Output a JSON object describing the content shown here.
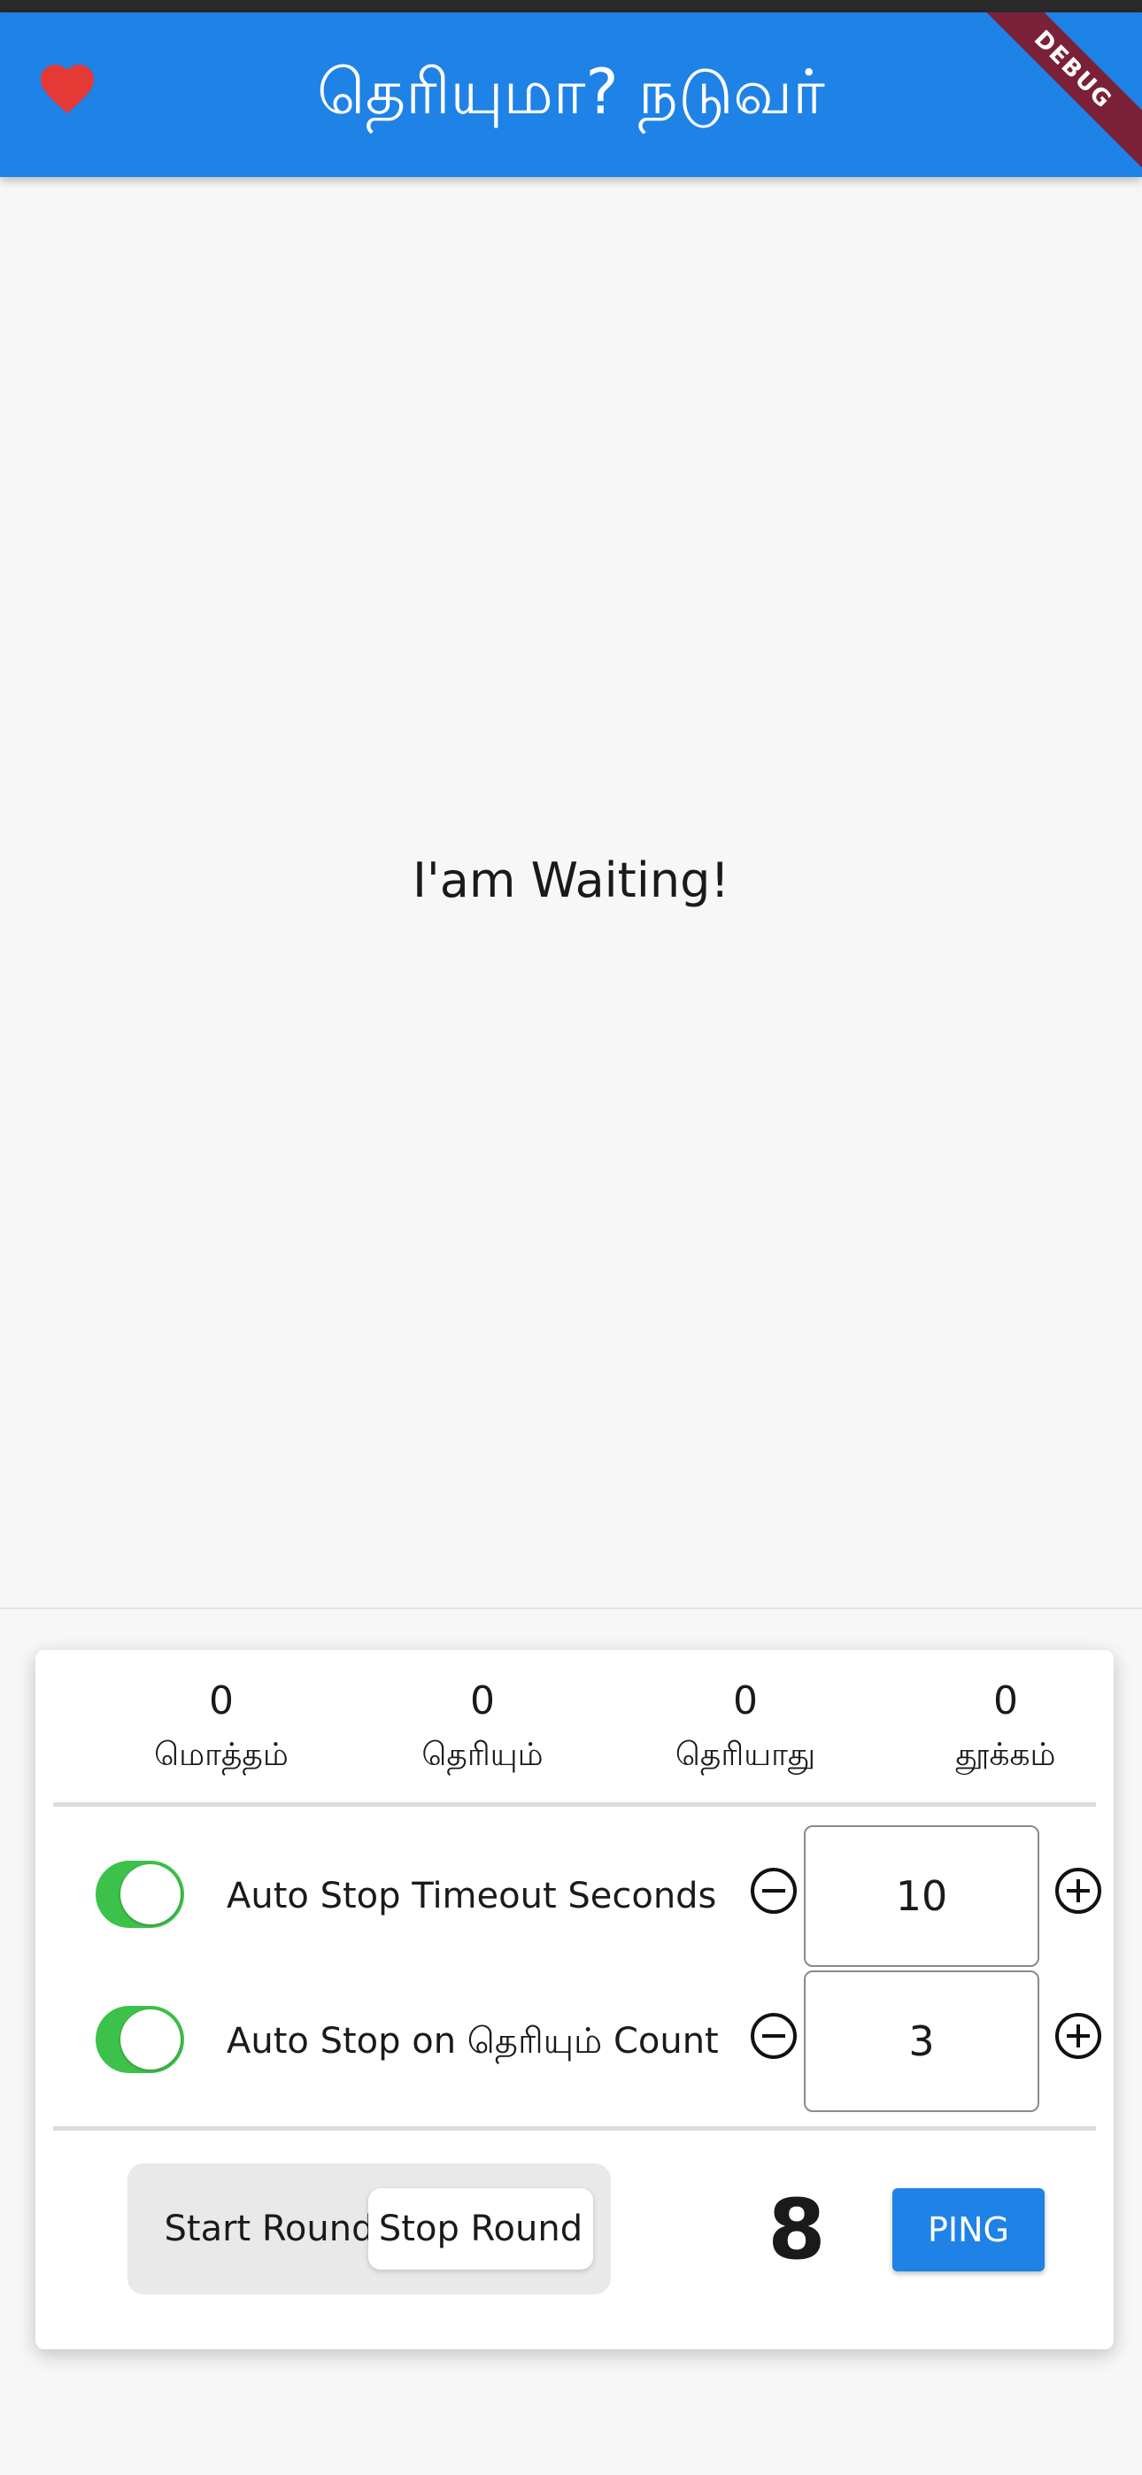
{
  "app_bar": {
    "title": "தெரியுமா? நடுவர்",
    "debug_label": "DEBUG",
    "heart_icon": "heart-icon",
    "accent_color": "#1f82e6"
  },
  "main": {
    "status_text": "I'am Waiting!"
  },
  "stats": [
    {
      "value": "0",
      "label": "மொத்தம்"
    },
    {
      "value": "0",
      "label": "தெரியும்"
    },
    {
      "value": "0",
      "label": "தெரியாது"
    },
    {
      "value": "0",
      "label": "தூக்கம்"
    }
  ],
  "settings": [
    {
      "label": "Auto Stop Timeout Seconds",
      "enabled": true,
      "value": "10"
    },
    {
      "label": "Auto Stop on தெரியும் Count",
      "enabled": true,
      "value": "3"
    }
  ],
  "round_controls": {
    "options": [
      "Start Round",
      "Stop Round"
    ],
    "selected": "Stop Round",
    "counter": "8",
    "ping_label": "PING"
  }
}
